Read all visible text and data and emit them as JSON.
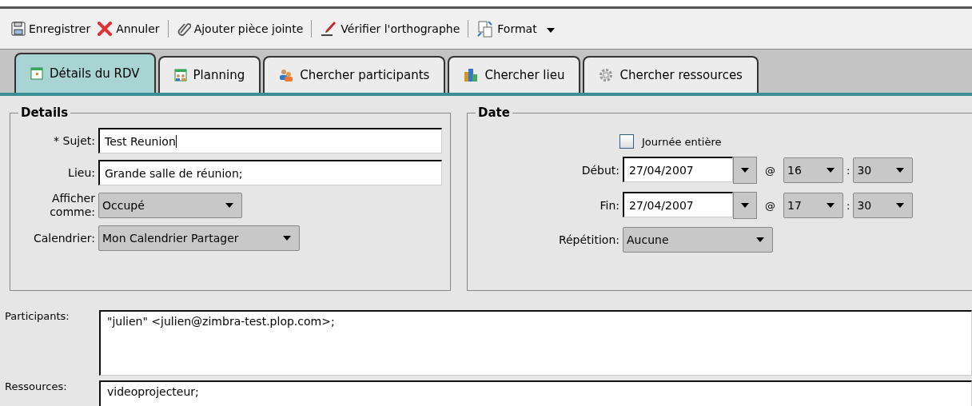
{
  "toolbar": [
    {
      "kind": "save",
      "label": "Enregistrer"
    },
    {
      "kind": "cancel",
      "label": "Annuler"
    },
    {
      "kind": "attach",
      "label": "Ajouter pièce jointe"
    },
    {
      "kind": "spell",
      "label": "Vérifier l'orthographe"
    },
    {
      "kind": "format",
      "label": "Format"
    }
  ],
  "tabs": [
    {
      "kind": "calendar",
      "label": "Détails du RDV",
      "selected": true
    },
    {
      "kind": "schedule",
      "label": "Planning",
      "selected": false
    },
    {
      "kind": "people",
      "label": "Chercher participants",
      "selected": false
    },
    {
      "kind": "building",
      "label": "Chercher lieu",
      "selected": false
    },
    {
      "kind": "gear",
      "label": "Chercher ressources",
      "selected": false
    }
  ],
  "details": {
    "title": "Details",
    "subject": {
      "label": "* Sujet:",
      "value": "Test Reunion"
    },
    "location": {
      "label": "Lieu:",
      "value": "Grande salle de réunion;"
    },
    "show_as": {
      "label": "Afficher comme:",
      "value": "Occupé"
    },
    "calendar": {
      "label": "Calendrier:",
      "value": "Mon Calendrier Partager"
    }
  },
  "date": {
    "title": "Date",
    "all_day": {
      "label": "Journée entière",
      "checked": false
    },
    "start": {
      "label": "Début:",
      "date": "27/04/2007",
      "at": "@",
      "hour": "16",
      "sep": ":",
      "minute": "30"
    },
    "end": {
      "label": "Fin:",
      "date": "27/04/2007",
      "at": "@",
      "hour": "17",
      "sep": ":",
      "minute": "30"
    },
    "repeat": {
      "label": "Répétition:",
      "value": "Aucune"
    }
  },
  "attendees": {
    "label": "Participants:",
    "value": "\"julien\" <julien@zimbra-test.plop.com>;"
  },
  "resources": {
    "label": "Ressources:",
    "value": "videoprojecteur;"
  }
}
